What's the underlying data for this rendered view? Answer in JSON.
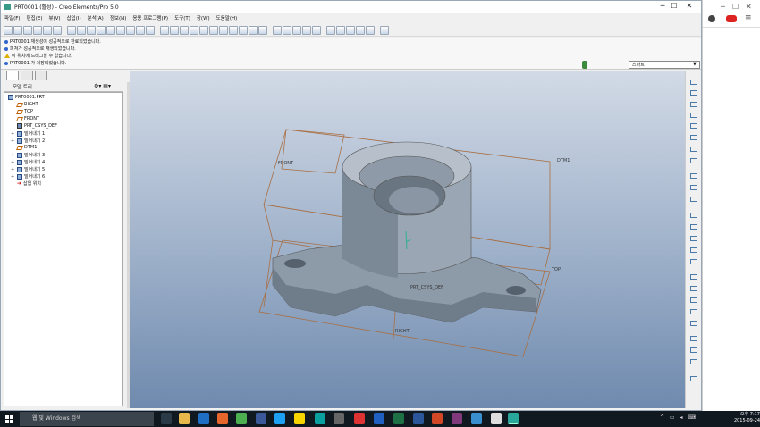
{
  "window": {
    "title": "PRT0001 (활성) - Creo Elements/Pro 5.0",
    "controls": [
      "─",
      "☐",
      "✕"
    ]
  },
  "menu": [
    "파일(F)",
    "편집(E)",
    "뷰(V)",
    "삽입(I)",
    "분석(A)",
    "정보(N)",
    "응용 프로그램(P)",
    "도구(T)",
    "창(W)",
    "도움말(H)"
  ],
  "messages": [
    {
      "icon": "info",
      "text": "PRT0001 재생성이 성공적으로 완료되었습니다."
    },
    {
      "icon": "info",
      "text": "피쳐가 성공적으로 재생되었습니다."
    },
    {
      "icon": "warning",
      "text": "이 위치에 드래그할 수 없습니다."
    },
    {
      "icon": "info",
      "text": "PRT0001 가 저장되었습니다."
    }
  ],
  "smart_select": "스마트",
  "model_tree": {
    "tab_label": "모델 트리",
    "items": [
      {
        "icon": "part",
        "text": "PRT0001.PRT",
        "expand": ""
      },
      {
        "icon": "plane",
        "text": "RIGHT",
        "expand": ""
      },
      {
        "icon": "plane",
        "text": "TOP",
        "expand": ""
      },
      {
        "icon": "plane",
        "text": "FRONT",
        "expand": ""
      },
      {
        "icon": "csys",
        "text": "PRT_CSYS_DEF",
        "expand": ""
      },
      {
        "icon": "feature",
        "text": "밀어내기 1",
        "expand": "+"
      },
      {
        "icon": "feature",
        "text": "밀어내기 2",
        "expand": "+"
      },
      {
        "icon": "plane",
        "text": "DTM1",
        "expand": ""
      },
      {
        "icon": "feature",
        "text": "밀어내기 3",
        "expand": "+"
      },
      {
        "icon": "feature",
        "text": "밀어내기 4",
        "expand": "+"
      },
      {
        "icon": "feature",
        "text": "밀어내기 5",
        "expand": "+"
      },
      {
        "icon": "feature",
        "text": "밀어내기 6",
        "expand": "+"
      },
      {
        "icon": "insert",
        "text": "삽입 위치",
        "expand": ""
      }
    ]
  },
  "viewport_labels": {
    "front": "FRONT",
    "dtm1": "DTM1",
    "top": "TOP",
    "right": "RIGHT",
    "csys": "PRT_CSYS_DEF"
  },
  "taskbar": {
    "search_placeholder": "웹 및 Windows 검색",
    "time": "오후 7:17",
    "date": "2015-09-24"
  }
}
